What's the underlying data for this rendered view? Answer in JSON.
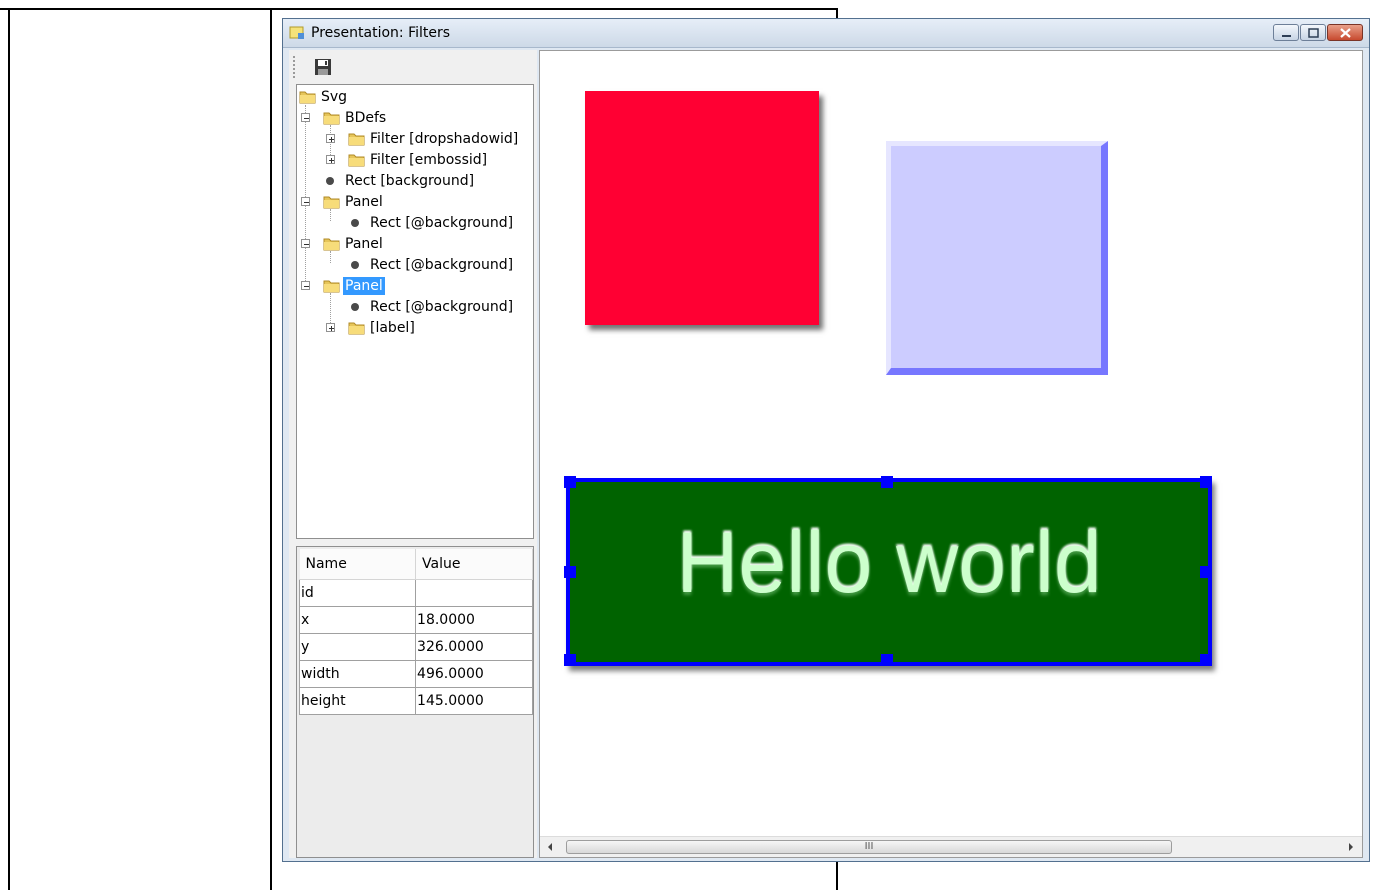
{
  "window": {
    "title": "Presentation: Filters",
    "buttons": [
      "minimize",
      "maximize",
      "close"
    ]
  },
  "toolbar": {
    "save_icon": "floppy-disk-save-icon"
  },
  "tree": {
    "nodes": [
      {
        "label": "Svg",
        "kind": "folder",
        "depth": 0
      },
      {
        "label": "BDefs",
        "kind": "folder",
        "depth": 1,
        "expanded": true
      },
      {
        "label": "Filter [dropshadowid]",
        "kind": "folder",
        "depth": 2,
        "expanded": false
      },
      {
        "label": "Filter [embossid]",
        "kind": "folder",
        "depth": 2,
        "expanded": false
      },
      {
        "label": "Rect [background]",
        "kind": "leaf",
        "depth": 1
      },
      {
        "label": "Panel",
        "kind": "folder",
        "depth": 1,
        "expanded": true
      },
      {
        "label": "Rect [@background]",
        "kind": "leaf",
        "depth": 2
      },
      {
        "label": "Panel",
        "kind": "folder",
        "depth": 1,
        "expanded": true
      },
      {
        "label": "Rect [@background]",
        "kind": "leaf",
        "depth": 2
      },
      {
        "label": "Panel",
        "kind": "folder",
        "depth": 1,
        "expanded": true,
        "selected": true
      },
      {
        "label": "Rect [@background]",
        "kind": "leaf",
        "depth": 2
      },
      {
        "label": "[label]",
        "kind": "folder",
        "depth": 2,
        "expanded": false
      }
    ]
  },
  "properties": {
    "headers": [
      "Name",
      "Value"
    ],
    "rows": [
      {
        "name": "id",
        "value": ""
      },
      {
        "name": "x",
        "value": "18.0000"
      },
      {
        "name": "y",
        "value": "326.0000"
      },
      {
        "name": "width",
        "value": "496.0000"
      },
      {
        "name": "height",
        "value": "145.0000"
      }
    ]
  },
  "canvas": {
    "panel_text": "Hello world",
    "colors": {
      "red_rect": "#ff0033",
      "emboss_rect": "#ccccff",
      "green_panel": "#006300",
      "selection": "#0000ff",
      "panel_text": "#ccffcc"
    }
  },
  "scrollbar": {
    "grip": "III"
  }
}
